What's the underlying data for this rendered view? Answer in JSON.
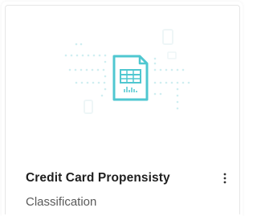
{
  "card": {
    "title": "Credit Card Propensisty",
    "subtitle": "Classification",
    "menu_icon": "more-vertical-icon",
    "illustration_icon": "spreadsheet-document-icon",
    "accent_color": "#4fc7d0",
    "dot_color": "#cfeef1"
  }
}
